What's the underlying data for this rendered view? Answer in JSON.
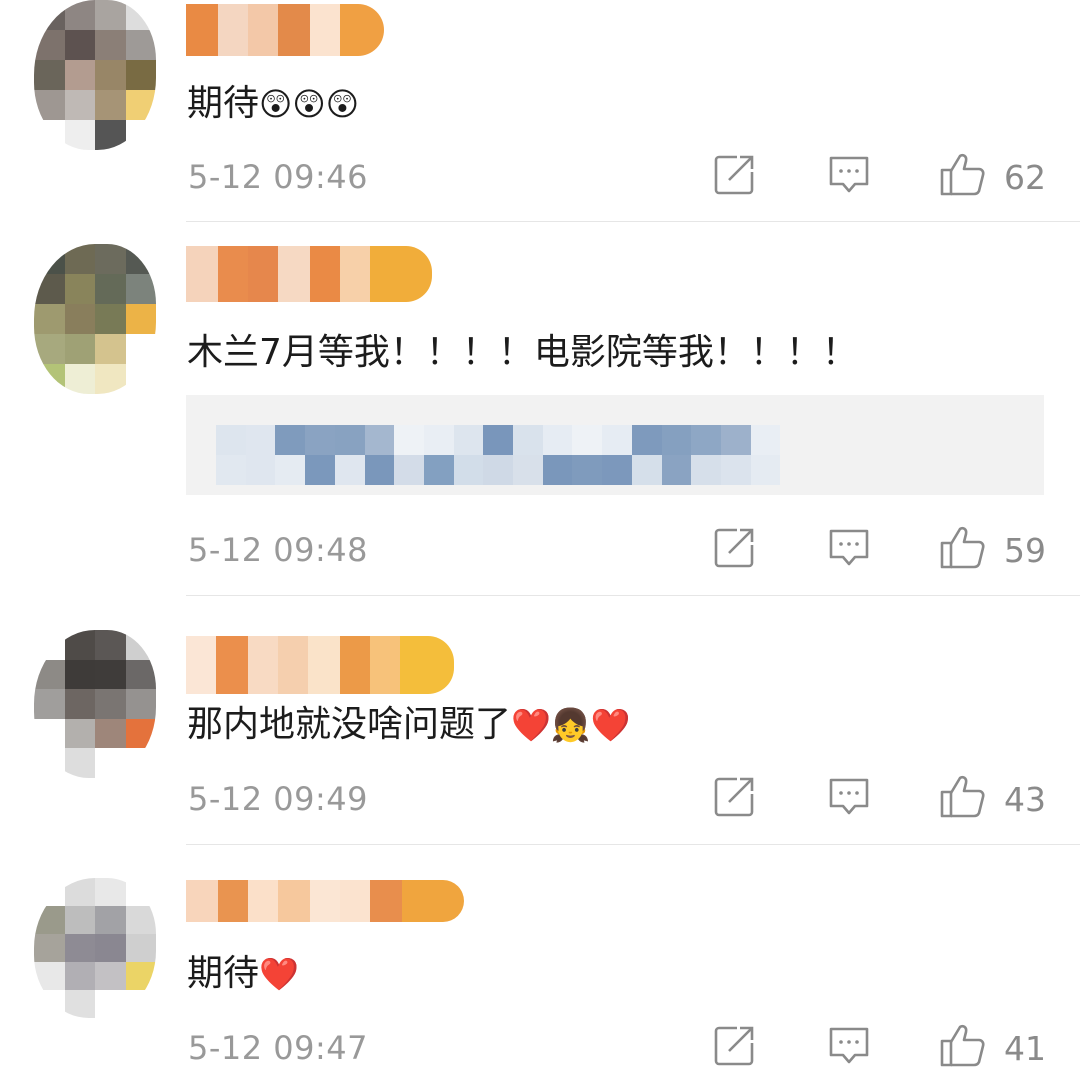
{
  "colors": {
    "text": "#1c1c1c",
    "meta": "#999999",
    "icon": "#8a8a8a",
    "divider": "#e6e6e6",
    "quote_bg": "#f2f2f2",
    "heart": "#e0202a"
  },
  "comments": [
    {
      "text": "期待",
      "emojis": [
        "😲",
        "😲",
        "😲"
      ],
      "time": "5-12 09:46",
      "likes": "62"
    },
    {
      "text": "木兰7月等我！！！！电影院等我！！！！",
      "emojis": [],
      "time": "5-12 09:48",
      "likes": "59"
    },
    {
      "text": "那内地就没啥问题了",
      "emojis": [
        "❤️",
        "👧",
        "❤️"
      ],
      "time": "5-12 09:49",
      "likes": "43"
    },
    {
      "text": "期待",
      "emojis": [
        "❤️"
      ],
      "time": "5-12 09:47",
      "likes": "41"
    }
  ],
  "icons": {
    "forward": "forward-icon",
    "comment": "comment-icon",
    "like": "thumbs-up-icon"
  }
}
